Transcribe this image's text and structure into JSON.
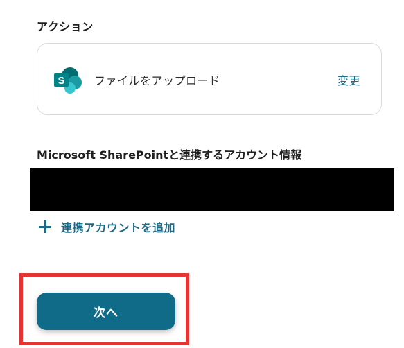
{
  "action_section": {
    "label": "アクション",
    "action_name": "ファイルをアップロード",
    "change_label": "変更",
    "app_icon": "sharepoint-logo-icon",
    "logo_letter": "S"
  },
  "account_section": {
    "heading": "Microsoft SharePointと連携するアカウント情報",
    "add_account_label": "連携アカウントを追加",
    "add_icon": "plus-icon"
  },
  "footer": {
    "next_label": "次へ"
  },
  "colors": {
    "accent": "#1d6a85",
    "button": "#0f6b87",
    "highlight": "#e53434",
    "sharepoint_dark": "#036c70",
    "sharepoint_mid": "#1a9ba1",
    "sharepoint_light": "#37c6d0"
  }
}
